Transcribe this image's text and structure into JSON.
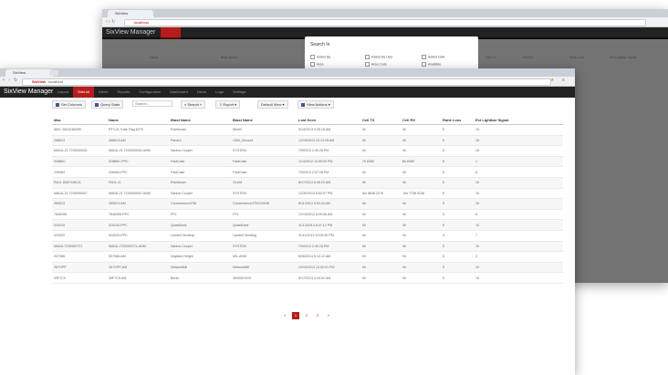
{
  "browser": {
    "tab_title": "SixView",
    "address": "localhost",
    "address_brand": "SixView"
  },
  "back": {
    "tab_title": "SixView",
    "address": "localhost",
    "brand": "SixView Manager",
    "modal_title": "Search In",
    "modal_options": [
      "Added By",
      "Added By User",
      "Added Date",
      "Area",
      "Area Code",
      "Available"
    ],
    "columns": [
      "Name",
      "Blast Name",
      "Lost Seen",
      "Cell TX",
      "Cell RX",
      "Rank Loss",
      "Ext Lightbar Signal"
    ]
  },
  "app": {
    "brand": "SixView Manager",
    "nav": [
      "Layout",
      "SiteList",
      "Alerts",
      "Reports",
      "Configuration",
      "Dashboard",
      "Users",
      "Logs",
      "Settings"
    ],
    "active_nav_index": 1,
    "toolbar": {
      "set_columns": "Set Columns",
      "query_state": "Query State",
      "search_placeholder": "Search...",
      "search": "Search",
      "export": "Export",
      "default_view": "Default View",
      "view_actions": "View Actions"
    }
  },
  "table": {
    "headers": [
      "Mac",
      "Name",
      "Blast Name",
      "Blast Name",
      "Lost Seen",
      "Cell TX",
      "Cell RX",
      "Rank Loss",
      "Ext Lightbar Signal"
    ],
    "rows": [
      [
        "8821 3A0324600B",
        "RT3-31 Gate Flag 8270",
        "Pointtower",
        "Merrill",
        "5/14/2013 3:30:18 AM",
        "0h",
        "0h",
        "5",
        "15"
      ],
      [
        "288613",
        "288613-AM",
        "Pandro",
        "1350_Second",
        "12/19/2013 10:13:25 AM",
        "0h",
        "0h",
        "5",
        "15"
      ],
      [
        "MADA-21 7230000032",
        "MADA-21 7230000032-ANM",
        "Santos Cooper",
        "SYSTEM",
        "7/9/2013 2:40:25 PM",
        "0h",
        "0h",
        "5",
        "15"
      ],
      [
        "028B6C",
        "028B6C-PPC",
        "FastCash",
        "FastCash",
        "1/14/2012 12:00:00 PM",
        "7h 6380",
        "8h 6380",
        "5",
        "1"
      ],
      [
        "228484",
        "228484-PPC",
        "FastCash",
        "FastCash",
        "7/9/2013 2:07:28 PM",
        "0h",
        "0h",
        "5",
        "8"
      ],
      [
        "RA11 8087949121",
        "RA11-11",
        "Pointtower",
        "OLAM",
        "6/17/2013 6:08:20 AM",
        "0h",
        "0h",
        "5",
        "15"
      ],
      [
        "MADA-21 7230000047",
        "MADA-21 7230000047-ANM",
        "Santos Cooper",
        "SYSTEM",
        "12/30/2013 6:53:07 PM",
        "6m 8836.2276",
        "-5m 7738.9236",
        "5",
        "15"
      ],
      [
        "269513",
        "269513-AM",
        "Convenience4TM",
        "Convenience4TM120036",
        "8/11/2013 6:59:44 AM",
        "0h",
        "0h",
        "5",
        "15"
      ],
      [
        "7848398",
        "7848398-PPC",
        "FPL",
        "FPL",
        "12/13/2012 6:09:08 AM",
        "0h",
        "0h",
        "5",
        "6"
      ],
      [
        "020234",
        "020234-PPC",
        "QuickBank",
        "QuickBank",
        "11/13/2013 6:47:12 PM",
        "0h",
        "0h",
        "5",
        "15"
      ],
      [
        "024020",
        "024020-PPC",
        "Landell Vending",
        "Landell Vending",
        "11/11/2013 10:00:30 PM",
        "0h",
        "0h",
        "4",
        "7"
      ],
      [
        "MADA 7230000721",
        "MADA-7230000721-ANM",
        "Santos Cooper",
        "SYSTEM",
        "7/9/2013 2:40:25 PM",
        "0h",
        "0h",
        "5",
        "15"
      ],
      [
        "007066",
        "007066-AM",
        "Dayland Height",
        "MIL.ANM",
        "8/26/2013 5:14:12 AM",
        "0h",
        "0h",
        "5",
        "3"
      ],
      [
        "267GPP",
        "267GPP-AM",
        "NetworkBill",
        "NetworkBill",
        "12/10/2013 12:00:01 PM",
        "0h",
        "0h",
        "5",
        "15"
      ],
      [
        "39F7C9",
        "39F7C9-AM",
        "Berlin",
        "3840001910",
        "8/17/2013 4:34:52 AM",
        "0h",
        "0h",
        "5",
        "15"
      ]
    ]
  },
  "pager": {
    "prev": "«",
    "pages": [
      "1",
      "2",
      "3"
    ],
    "next": "»",
    "active_index": 0
  },
  "colors": {
    "accent": "#b71c1c",
    "navbar": "#222222",
    "link": "#3b5998"
  }
}
